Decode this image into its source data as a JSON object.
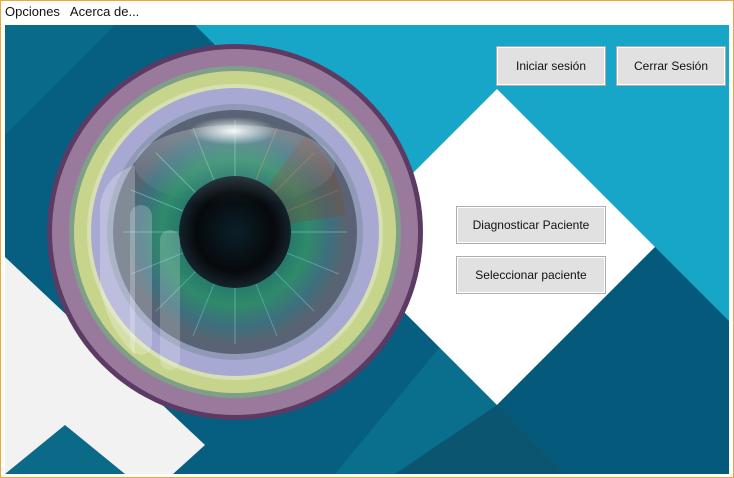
{
  "menubar": {
    "items": [
      {
        "label": "Opciones"
      },
      {
        "label": "Acerca de..."
      }
    ]
  },
  "session": {
    "login_label": "Iniciar sesión",
    "logout_label": "Cerrar Sesión"
  },
  "patient": {
    "diagnose_label": "Diagnosticar Paciente",
    "select_label": "Seleccionar paciente"
  },
  "theme": {
    "window_border": "#f0a63b",
    "teal_dark": "#065f80",
    "teal_mid": "#0c7c9a",
    "teal_light": "#17a6c8",
    "ring_purple": "#9a7a9c",
    "ring_green": "#c7d58c",
    "ring_lavender": "#a7a9d2",
    "iris_green": "#2f8a6a",
    "pupil": "#06090c"
  },
  "artwork": {
    "main_image": "eye-icon"
  }
}
